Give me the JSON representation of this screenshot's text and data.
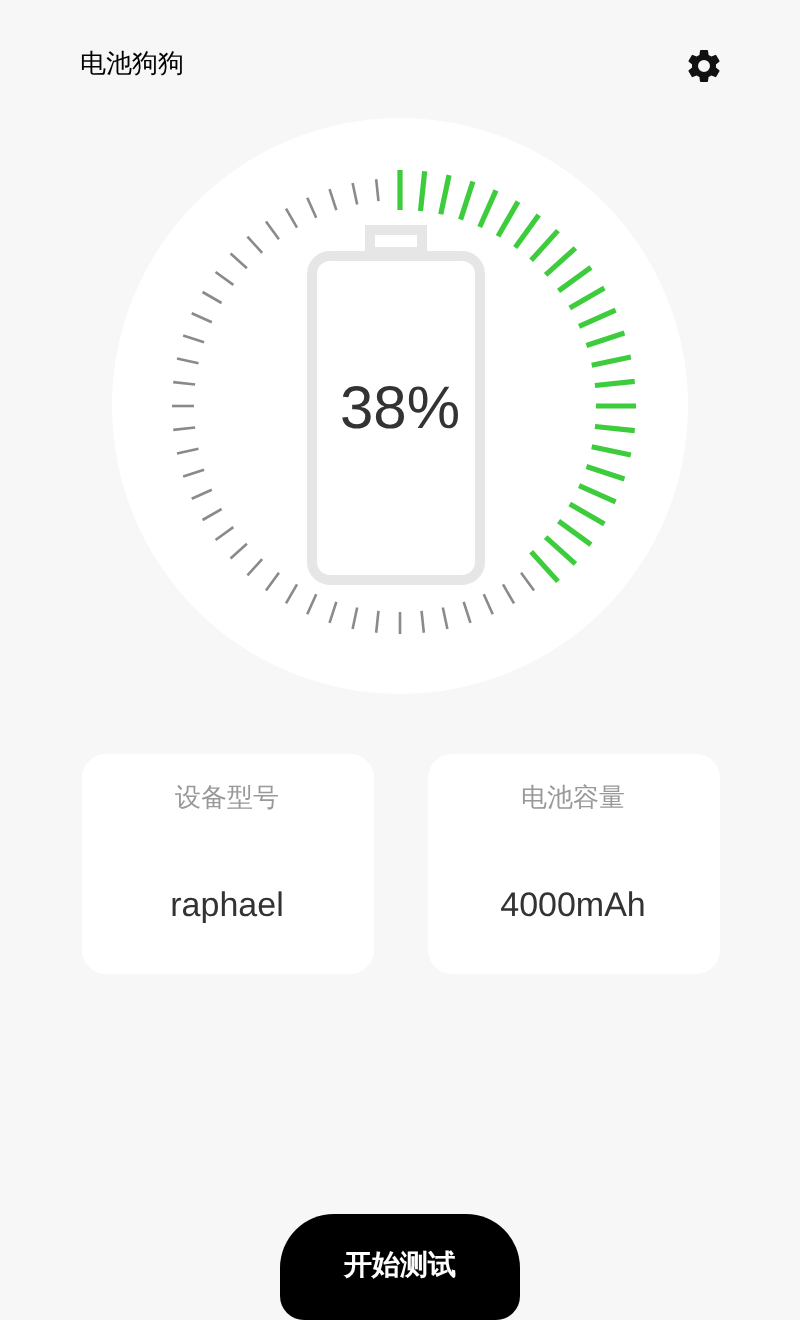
{
  "app_bar": {
    "title": "电池狗狗"
  },
  "battery": {
    "percent": "38%"
  },
  "info_cards": [
    {
      "label": "设备型号",
      "value": "raphael"
    },
    {
      "label": "电池容量",
      "value": "4000mAh"
    }
  ],
  "start_button": {
    "label": "开始测试"
  }
}
